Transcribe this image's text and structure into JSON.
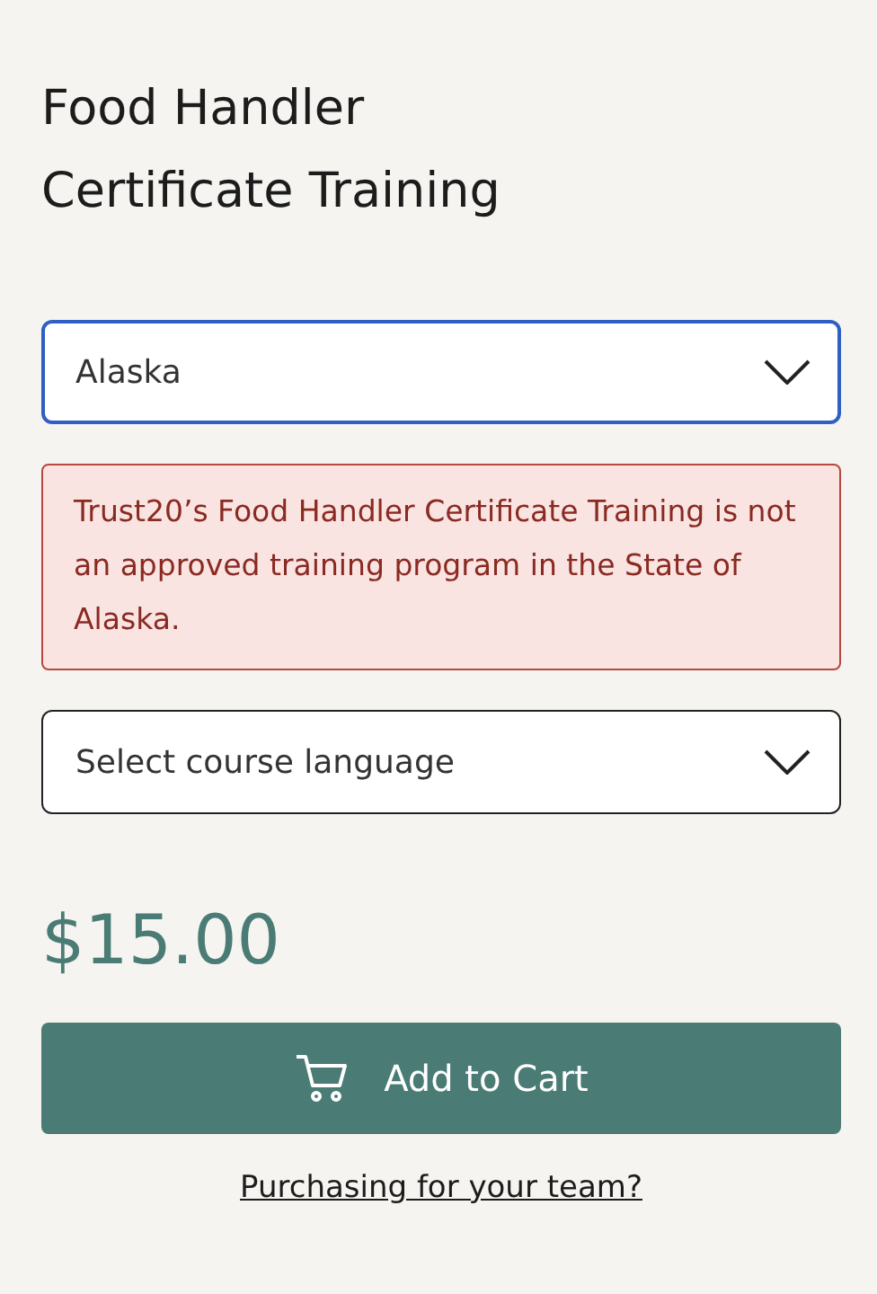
{
  "title": "Food Handler Certificate Training",
  "state_select": {
    "value": "Alaska",
    "focused": true
  },
  "alert": {
    "text": "Trust20’s Food Handler Certificate Training is not an approved training program in the State of Alaska."
  },
  "language_select": {
    "placeholder": "Select course language",
    "focused": false
  },
  "price": "$15.00",
  "add_button": {
    "label": "Add to Cart"
  },
  "team_link": "Purchasing for your team?"
}
